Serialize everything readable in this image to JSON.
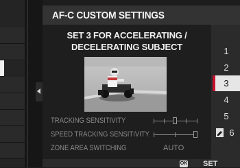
{
  "dialog": {
    "title": "AF-C CUSTOM SETTINGS",
    "description_line1": "SET 3 FOR ACCELERATING /",
    "description_line2": "DECELERATING SUBJECT"
  },
  "settings": [
    {
      "label": "TRACKING SENSITIVITY",
      "level": 3,
      "levels": 5
    },
    {
      "label": "SPEED TRACKING SENSITIVITY",
      "level": 3,
      "levels": 3
    },
    {
      "label": "ZONE AREA SWITCHING",
      "value": "AUTO"
    }
  ],
  "set_list": {
    "items": [
      "1",
      "2",
      "3",
      "4",
      "5",
      "6"
    ],
    "selected": "3",
    "custom_item": "6"
  },
  "footer": {
    "ok_label": "OK",
    "set_label": "SET"
  },
  "colors": {
    "accent": "#c8102e",
    "selected_bg": "#e6e6e6",
    "dim_text": "#8a8a8a"
  }
}
